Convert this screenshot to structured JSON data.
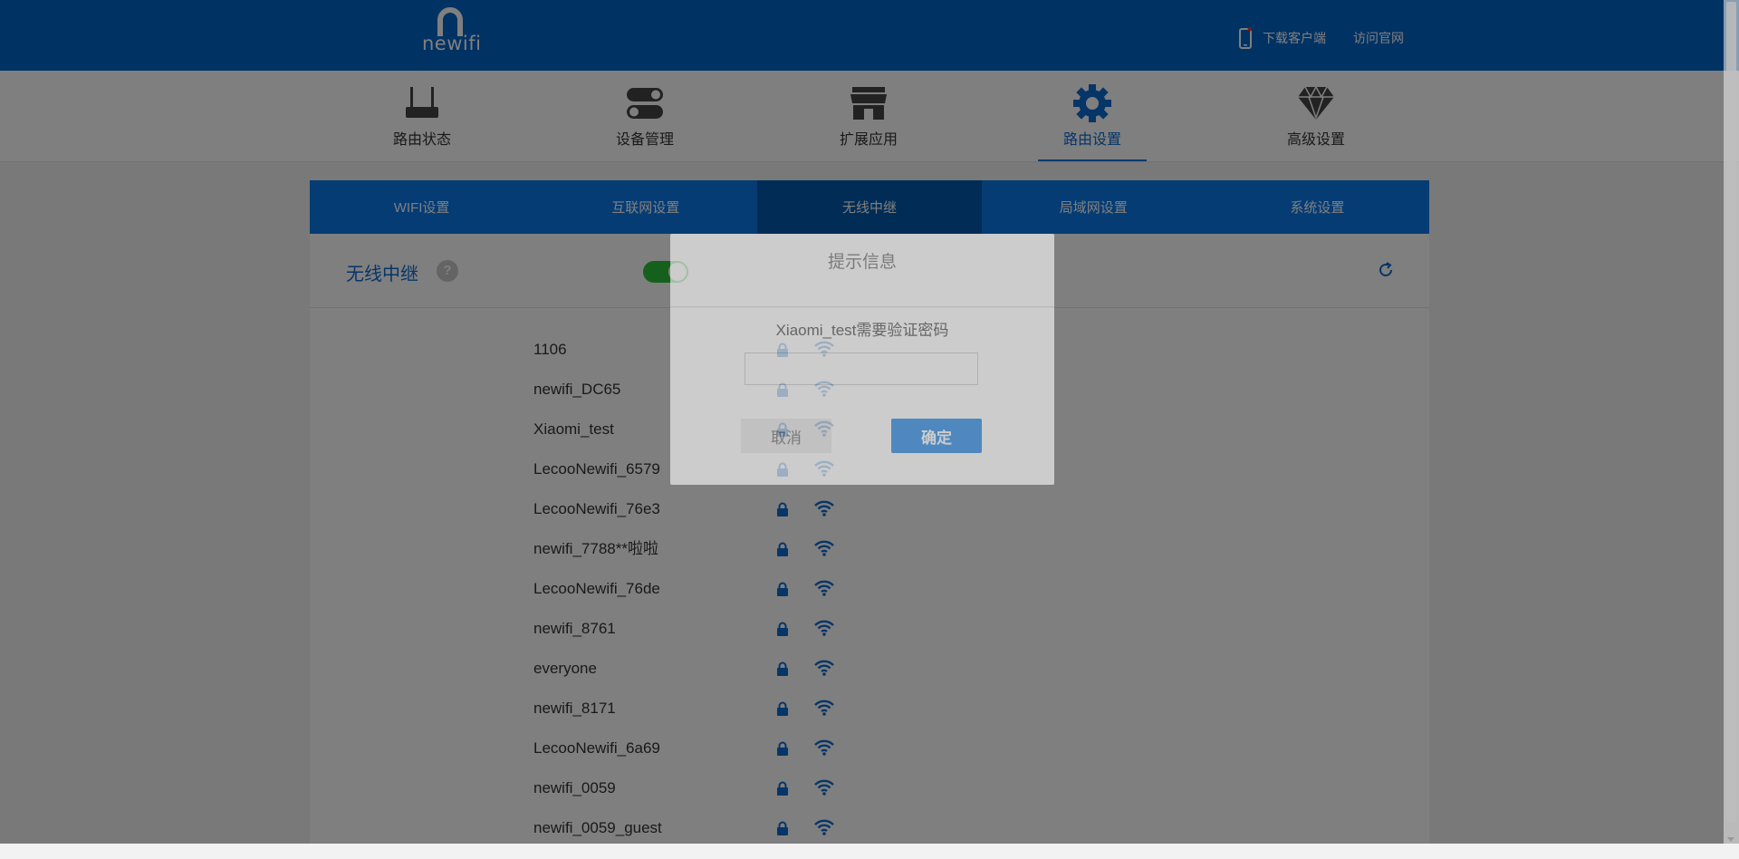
{
  "header": {
    "logo_text": "newifi",
    "download_client": "下载客户端",
    "visit_site": "访问官网"
  },
  "main_nav": [
    {
      "label": "路由状态",
      "icon": "router-icon",
      "active": false
    },
    {
      "label": "设备管理",
      "icon": "toggle-switches-icon",
      "active": false
    },
    {
      "label": "扩展应用",
      "icon": "store-icon",
      "active": false
    },
    {
      "label": "路由设置",
      "icon": "gear-icon",
      "active": true
    },
    {
      "label": "高级设置",
      "icon": "diamond-icon",
      "active": false
    }
  ],
  "sub_tabs": [
    {
      "label": "WIFI设置",
      "active": false
    },
    {
      "label": "互联网设置",
      "active": false
    },
    {
      "label": "无线中继",
      "active": true
    },
    {
      "label": "局域网设置",
      "active": false
    },
    {
      "label": "系统设置",
      "active": false
    }
  ],
  "section": {
    "title": "无线中继",
    "help": "?",
    "toggle_on": true
  },
  "wifi_list": [
    {
      "ssid": "1106"
    },
    {
      "ssid": "newifi_DC65"
    },
    {
      "ssid": "Xiaomi_test"
    },
    {
      "ssid": "LecooNewifi_6579"
    },
    {
      "ssid": "LecooNewifi_76e3"
    },
    {
      "ssid": "newifi_7788**啦啦"
    },
    {
      "ssid": "LecooNewifi_76de"
    },
    {
      "ssid": "newifi_8761"
    },
    {
      "ssid": "everyone"
    },
    {
      "ssid": "newifi_8171"
    },
    {
      "ssid": "LecooNewifi_6a69"
    },
    {
      "ssid": "newifi_0059"
    },
    {
      "ssid": "newifi_0059_guest"
    }
  ],
  "dialog": {
    "title": "提示信息",
    "message": "Xiaomi_test需要验证密码",
    "password_value": "",
    "cancel_label": "取消",
    "ok_label": "确定"
  },
  "colors": {
    "header_blue": "#0065c8",
    "tab_blue": "#0a78e8",
    "tab_active": "#0058ac",
    "accent": "#0c6ad0",
    "toggle_green": "#2bc03a"
  }
}
